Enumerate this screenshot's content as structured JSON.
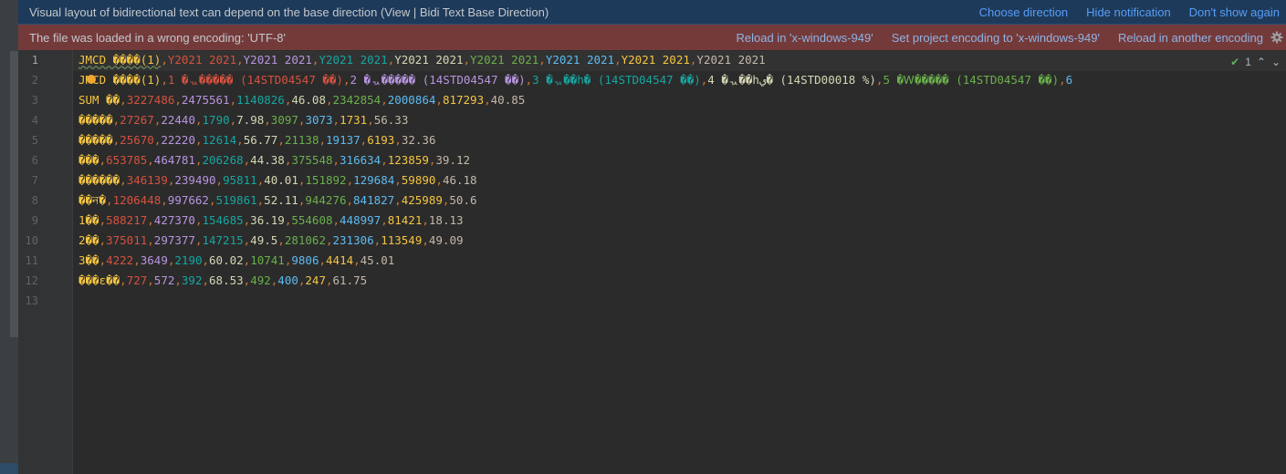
{
  "info_banner": {
    "message": "Visual layout of bidirectional text can depend on the base direction (View | Bidi Text Base Direction)",
    "actions": [
      "Choose direction",
      "Hide notification",
      "Don't show again"
    ]
  },
  "warn_banner": {
    "message": "The file was loaded in a wrong encoding: 'UTF-8'",
    "actions": [
      "Reload in 'x-windows-949'",
      "Set project encoding to 'x-windows-949'",
      "Reload in another encoding"
    ],
    "gear_icon": "gear-icon"
  },
  "inspection": {
    "count": "1",
    "check_icon": "check-icon"
  },
  "colors": {
    "info_bg": "#1e3a5a",
    "warn_bg": "#743a3a",
    "editor_bg": "#2b2b2b",
    "link": "#589df6"
  },
  "line_numbers": [
    "1",
    "2",
    "3",
    "4",
    "5",
    "6",
    "7",
    "8",
    "9",
    "10",
    "11",
    "12",
    "13"
  ],
  "lines": [
    [
      "JMCD ����(1)",
      "Y2021 2021",
      "Y2021 2021",
      "Y2021 2021",
      "Y2021 2021",
      "Y2021 2021",
      "Y2021 2021",
      "Y2021 2021",
      "Y2021 2021"
    ],
    [
      "JMCD ����(1)",
      "1 �ᆪ����� (14STD04547 ��)",
      "2 �ᆪ����� (14STD04547 ��)",
      "3 �ᆪ��h� (14STD04547 ��)",
      "4 �ᆪ��hي� (14STD00018 %)",
      "5 �Ꮃ����� (14STD04547 ��)",
      "6"
    ],
    [
      "SUM ��",
      "3227486",
      "2475561",
      "1140826",
      "46.08",
      "2342854",
      "2000864",
      "817293",
      "40.85"
    ],
    [
      "�����",
      "27267",
      "22440",
      "1790",
      "7.98",
      "3097",
      "3073",
      "1731",
      "56.33"
    ],
    [
      "�����",
      "25670",
      "22220",
      "12614",
      "56.77",
      "21138",
      "19137",
      "6193",
      "32.36"
    ],
    [
      "���",
      "653785",
      "464781",
      "206268",
      "44.38",
      "375548",
      "316634",
      "123859",
      "39.12"
    ],
    [
      "������",
      "346139",
      "239490",
      "95811",
      "40.01",
      "151892",
      "129684",
      "59890",
      "46.18"
    ],
    [
      "��ন�",
      "1206448",
      "997662",
      "519861",
      "52.11",
      "944276",
      "841827",
      "425989",
      "50.6"
    ],
    [
      "1��",
      "588217",
      "427370",
      "154685",
      "36.19",
      "554608",
      "448997",
      "81421",
      "18.13"
    ],
    [
      "2��",
      "375011",
      "297377",
      "147215",
      "49.5",
      "281062",
      "231306",
      "113549",
      "49.09"
    ],
    [
      "3��",
      "4222",
      "3649",
      "2190",
      "60.02",
      "10741",
      "9806",
      "4414",
      "45.01"
    ],
    [
      "���ε��",
      "727",
      "572",
      "392",
      "68.53",
      "492",
      "400",
      "247",
      "61.75"
    ],
    []
  ]
}
